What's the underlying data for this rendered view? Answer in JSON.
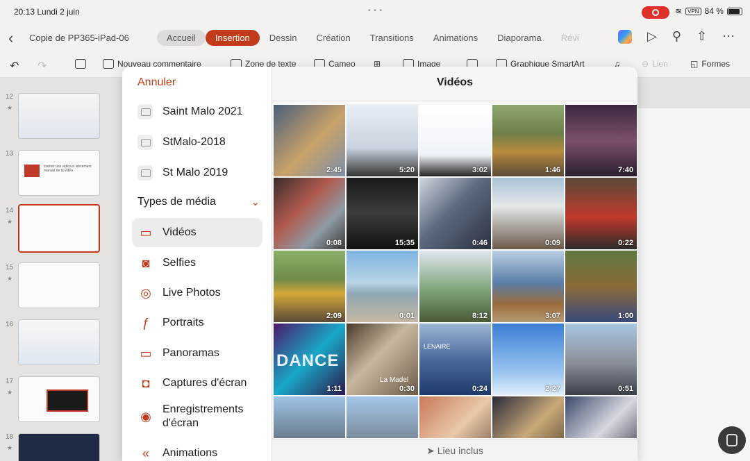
{
  "status": {
    "time": "20:13",
    "date": "Lundi 2 juin",
    "battery": "84 %",
    "vpn": "VPN"
  },
  "ribbon": {
    "doc_title": "Copie de PP365-iPad-06",
    "tabs": [
      "Accueil",
      "Insertion",
      "Dessin",
      "Création",
      "Transitions",
      "Animations",
      "Diaporama",
      "Révi"
    ],
    "active_tab": "Insertion"
  },
  "toolbar": {
    "new_comment": "Nouveau commentaire",
    "text_box": "Zone de texte",
    "cameo": "Cameo",
    "image": "Image",
    "smartart": "Graphique SmartArt",
    "link": "Lien",
    "shapes": "Formes"
  },
  "slides": [
    {
      "num": "12",
      "star": "★"
    },
    {
      "num": "13",
      "star": "",
      "caption": "Insérer une vidéo et lancement manuel de la vidéo"
    },
    {
      "num": "14",
      "star": "★"
    },
    {
      "num": "15",
      "star": "★"
    },
    {
      "num": "16",
      "star": ""
    },
    {
      "num": "17",
      "star": "★"
    },
    {
      "num": "18",
      "star": "★"
    }
  ],
  "picker": {
    "cancel": "Annuler",
    "title": "Vidéos",
    "albums": [
      "Saint Malo 2021",
      "StMalo-2018",
      "St Malo 2019"
    ],
    "media_types_label": "Types de média",
    "media_types": [
      {
        "label": "Vidéos",
        "icon": "video-icon",
        "glyph": "▭"
      },
      {
        "label": "Selfies",
        "icon": "selfie-icon",
        "glyph": "◙"
      },
      {
        "label": "Live Photos",
        "icon": "live-photo-icon",
        "glyph": "◎"
      },
      {
        "label": "Portraits",
        "icon": "portrait-icon",
        "glyph": "ƒ"
      },
      {
        "label": "Panoramas",
        "icon": "panorama-icon",
        "glyph": "▭"
      },
      {
        "label": "Captures d'écran",
        "icon": "screenshot-icon",
        "glyph": "◘"
      },
      {
        "label": "Enregistrements d'écran",
        "icon": "screen-recording-icon",
        "glyph": "◉"
      },
      {
        "label": "Animations",
        "icon": "animation-icon",
        "glyph": "«"
      }
    ],
    "videos": [
      {
        "duration": "2:45",
        "bg": "linear-gradient(135deg,#4b5f7a,#c9a26b 55%,#7d8fa8)"
      },
      {
        "duration": "5:20",
        "bg": "linear-gradient(180deg,#e8eef5,#c9d3df 60%,#333 100%)"
      },
      {
        "duration": "3:02",
        "bg": "linear-gradient(180deg,#ffffff,#eef3f9 70%,#222 100%)"
      },
      {
        "duration": "1:46",
        "bg": "linear-gradient(180deg,#8fa771,#6f7f4a 40%,#b88a3e 65%,#5b4b38)"
      },
      {
        "duration": "7:40",
        "bg": "linear-gradient(180deg,#3a2a3f,#7b4f6c 50%,#2a1f2e)"
      },
      {
        "duration": "0:08",
        "bg": "linear-gradient(135deg,#3b2c2a,#b05a4f 40%,#8e9aa3 70%,#3a3a3a)"
      },
      {
        "duration": "15:35",
        "bg": "linear-gradient(180deg,#1a1a1a,#3c3c3c 50%,#111)"
      },
      {
        "duration": "0:46",
        "bg": "linear-gradient(135deg,#cfd6de,#5c6a80 45%,#2a3140)"
      },
      {
        "duration": "0:09",
        "bg": "linear-gradient(180deg,#a8c3d8,#e4e7e9 40%,#6b5a4a)"
      },
      {
        "duration": "0:22",
        "bg": "linear-gradient(180deg,#5a4a3a,#c0392b 55%,#2b2b2b)"
      },
      {
        "duration": "2:09",
        "bg": "linear-gradient(180deg,#8db06a,#6f8a4a 40%,#d4a83a 60%,#5a4a38)"
      },
      {
        "duration": "0:01",
        "bg": "linear-gradient(180deg,#7fb4e0,#b7d4e6 45%,#8fa6b3 60%,#c4b8a3)"
      },
      {
        "duration": "8:12",
        "bg": "linear-gradient(180deg,#dfe6ee,#7fa37a 55%,#4a5a38)"
      },
      {
        "duration": "3:07",
        "bg": "linear-gradient(180deg,#b9cfe4,#5b7ea8 45%,#9b6b3d 75%,#b59b74)"
      },
      {
        "duration": "1:00",
        "bg": "linear-gradient(180deg,#5f7a3e,#8a6a3a 50%,#3a4a7a)"
      },
      {
        "duration": "1:11",
        "bg": "linear-gradient(135deg,#4a1a6a,#1aa8c8 50%,#2a1a4a)"
      },
      {
        "duration": "0:30",
        "bg": "linear-gradient(135deg,#4a3a2a,#c9b8a0 45%,#6a5a48)"
      },
      {
        "duration": "0:24",
        "bg": "linear-gradient(180deg,#9cb7d6,#4a6a9a 50%,#1f3a6a)"
      },
      {
        "duration": "2:27",
        "bg": "linear-gradient(180deg,#3a7ed6,#9ec6f0 70%,#dfeefa)"
      },
      {
        "duration": "0:51",
        "bg": "linear-gradient(180deg,#a9c6e2,#8a8f98 55%,#3a3f48)"
      },
      {
        "duration": "",
        "bg": "linear-gradient(180deg,#9ec3e6,#6a7a8a 60%,#3a4048)"
      },
      {
        "duration": "",
        "bg": "linear-gradient(180deg,#a5c8ea,#7a8a9a 60%,#4a4a4a)"
      },
      {
        "duration": "",
        "bg": "linear-gradient(135deg,#c87a5a,#e8c8a8 50%,#6a4a3a)"
      },
      {
        "duration": "",
        "bg": "linear-gradient(135deg,#2a2a3a,#c8a878 50%,#4a3a2a)"
      },
      {
        "duration": "",
        "bg": "linear-gradient(135deg,#3a4a6a,#d8d8e0 50%,#2a2a3a)"
      }
    ],
    "overlay_texts": {
      "dance": "DANCE",
      "madel": "La Madel",
      "lenaire": "LENAIRE"
    },
    "footer": "Lieu inclus"
  }
}
